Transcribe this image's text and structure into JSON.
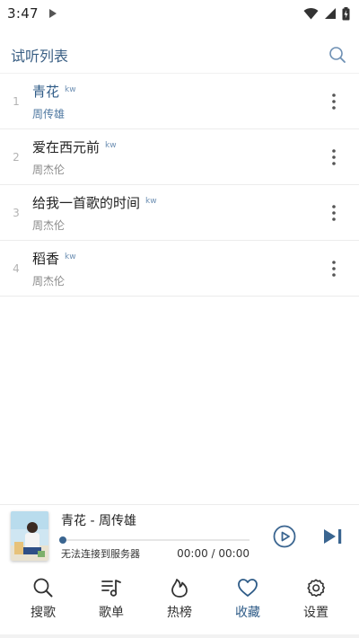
{
  "status_bar": {
    "time": "3:47"
  },
  "header": {
    "title": "试听列表"
  },
  "songs": [
    {
      "index": "1",
      "title": "青花",
      "source": "kw",
      "artist": "周传雄"
    },
    {
      "index": "2",
      "title": "爱在西元前",
      "source": "kw",
      "artist": "周杰伦"
    },
    {
      "index": "3",
      "title": "给我一首歌的时间",
      "source": "kw",
      "artist": "周杰伦"
    },
    {
      "index": "4",
      "title": "稻香",
      "source": "kw",
      "artist": "周杰伦"
    }
  ],
  "player": {
    "now_playing": "青花 - 周传雄",
    "status": "无法连接到服务器",
    "time": "00:00 / 00:00",
    "progress": 0
  },
  "nav": [
    {
      "label": "搜歌",
      "icon": "search-icon"
    },
    {
      "label": "歌单",
      "icon": "playlist-icon"
    },
    {
      "label": "热榜",
      "icon": "flame-icon"
    },
    {
      "label": "收藏",
      "icon": "heart-icon"
    },
    {
      "label": "设置",
      "icon": "gear-icon"
    }
  ],
  "colors": {
    "accent": "#2e5b87",
    "active_artist": "#4f78a1",
    "source_tag": "#6d8fb3"
  }
}
